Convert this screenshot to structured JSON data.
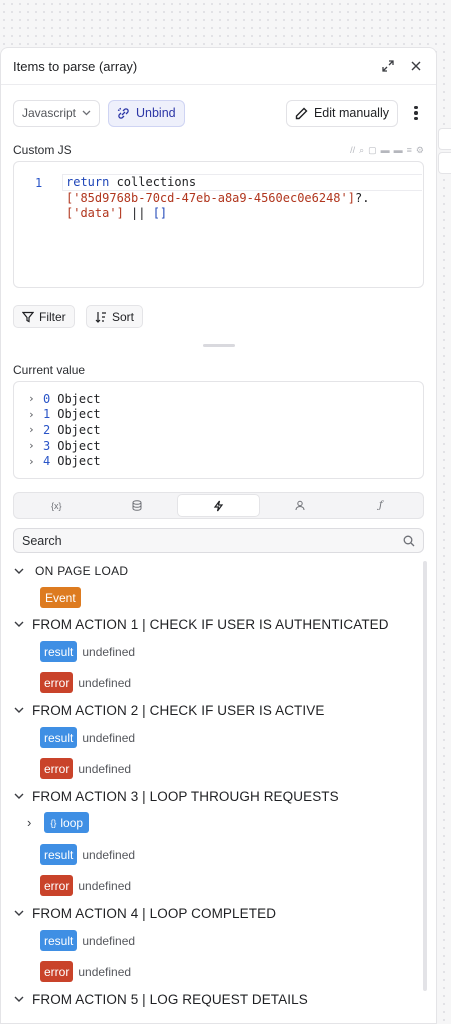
{
  "panel": {
    "title": "Items to parse (array)"
  },
  "toolbar": {
    "language": "Javascript",
    "unbind_label": "Unbind",
    "edit_label": "Edit manually"
  },
  "editor": {
    "label": "Custom JS",
    "line_number": "1",
    "line1_kw": "return",
    "line1_rest": " collections",
    "line2_str": "['85d9768b-70cd-47eb-a8a9-4560ec0e6248']",
    "line2_rest": "?.",
    "line3_str": "['data']",
    "line3_rest": " || ",
    "line3_arr": "[]"
  },
  "chips": {
    "filter": "Filter",
    "sort": "Sort"
  },
  "current_value": {
    "label": "Current value",
    "rows": [
      {
        "index": "0",
        "type": "Object"
      },
      {
        "index": "1",
        "type": "Object"
      },
      {
        "index": "2",
        "type": "Object"
      },
      {
        "index": "3",
        "type": "Object"
      },
      {
        "index": "4",
        "type": "Object"
      }
    ]
  },
  "tabs": [
    {
      "icon": "variable-icon",
      "glyph": "{x}"
    },
    {
      "icon": "database-icon",
      "glyph": ""
    },
    {
      "icon": "lightning-icon",
      "glyph": "",
      "active": true
    },
    {
      "icon": "user-icon",
      "glyph": ""
    },
    {
      "icon": "function-icon",
      "glyph": "ƒ"
    }
  ],
  "search": {
    "placeholder": "Search"
  },
  "tree": {
    "on_page_load": "ON PAGE LOAD",
    "event_label": "Event",
    "action1": "FROM ACTION 1 | CHECK IF USER IS AUTHENTICATED",
    "action2": "FROM ACTION 2 | CHECK IF USER IS ACTIVE",
    "action3": "FROM ACTION 3 | LOOP THROUGH REQUESTS",
    "action4": "FROM ACTION 4 | LOOP COMPLETED",
    "action5": "FROM ACTION 5 | LOG REQUEST DETAILS",
    "result_label": "result",
    "error_label": "error",
    "loop_label": "loop",
    "undefined_text": "undefined"
  },
  "colors": {
    "result": "#3f8fe4",
    "error": "#c9432a",
    "event": "#dd7b20",
    "unbind_bg": "#eef0fb"
  }
}
